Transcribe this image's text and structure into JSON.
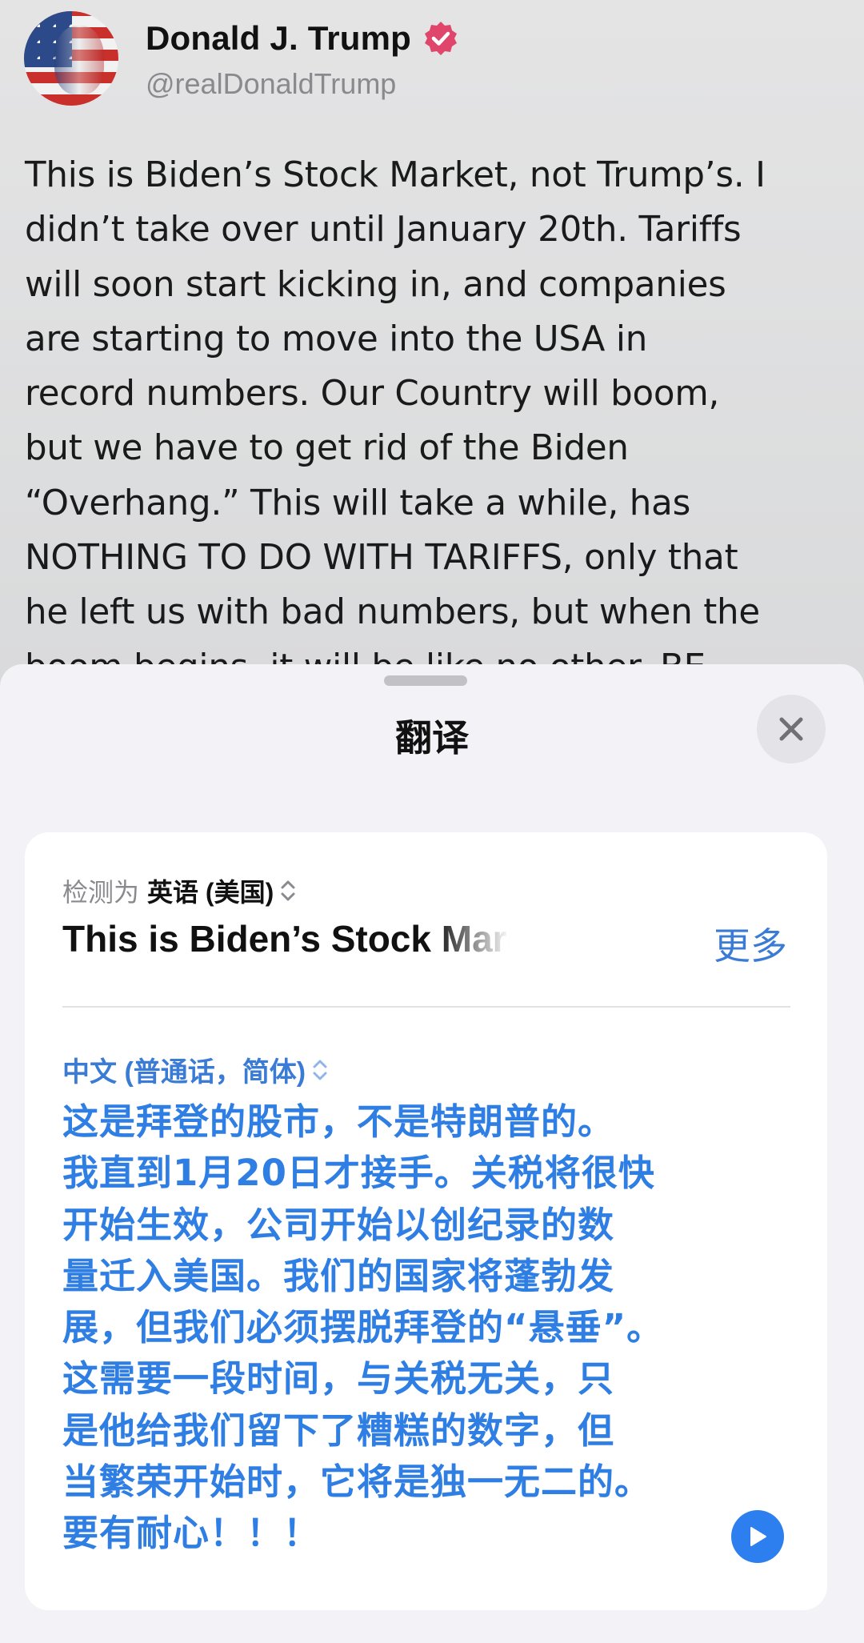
{
  "post": {
    "author_name": "Donald J. Trump",
    "handle": "@realDonaldTrump",
    "body_lines": [
      "This is Biden’s Stock Market, not Trump’s. I",
      "didn’t take over until January 20th. Tariffs",
      "will soon start kicking in, and companies",
      "are starting to move into the USA in",
      "record numbers. Our Country will boom,",
      "but we have to get rid of the Biden",
      "“Overhang.” This will take a while, has",
      "NOTHING TO DO WITH TARIFFS, only that",
      "he left us with bad numbers, but when the",
      "boom begins, it will be like no other. BE"
    ]
  },
  "translate_sheet": {
    "title": "翻译",
    "source": {
      "detected_prefix": "检测为",
      "language": "英语 (美国)",
      "text": "This is Biden’s Stock Market, not Trump’s.",
      "more_label": "更多"
    },
    "target": {
      "language": "中文 (普通话，简体)",
      "lines": [
        "这是拜登的股市，不是特朗普的。",
        "我直到1月20日才接手。关税将很快",
        "开始生效，公司开始以创纪录的数",
        "量迁入美国。我们的国家将蓬勃发",
        "展，但我们必须摆脱拜登的“悬垂”。",
        "这需要一段时间，与关税无关，只",
        "是他给我们留下了糟糕的数字，但",
        "当繁荣开始时，它将是独一无二的。",
        "要有耐心！！！"
      ]
    }
  },
  "colors": {
    "accent_blue": "#2f7ee3",
    "verified_badge": "#e0456b",
    "sheet_bg": "#f2f2f7"
  },
  "icons": {
    "verified": "verified-badge-icon",
    "close": "close-icon",
    "language_chevron": "chevron-updown-icon",
    "play": "play-icon"
  }
}
